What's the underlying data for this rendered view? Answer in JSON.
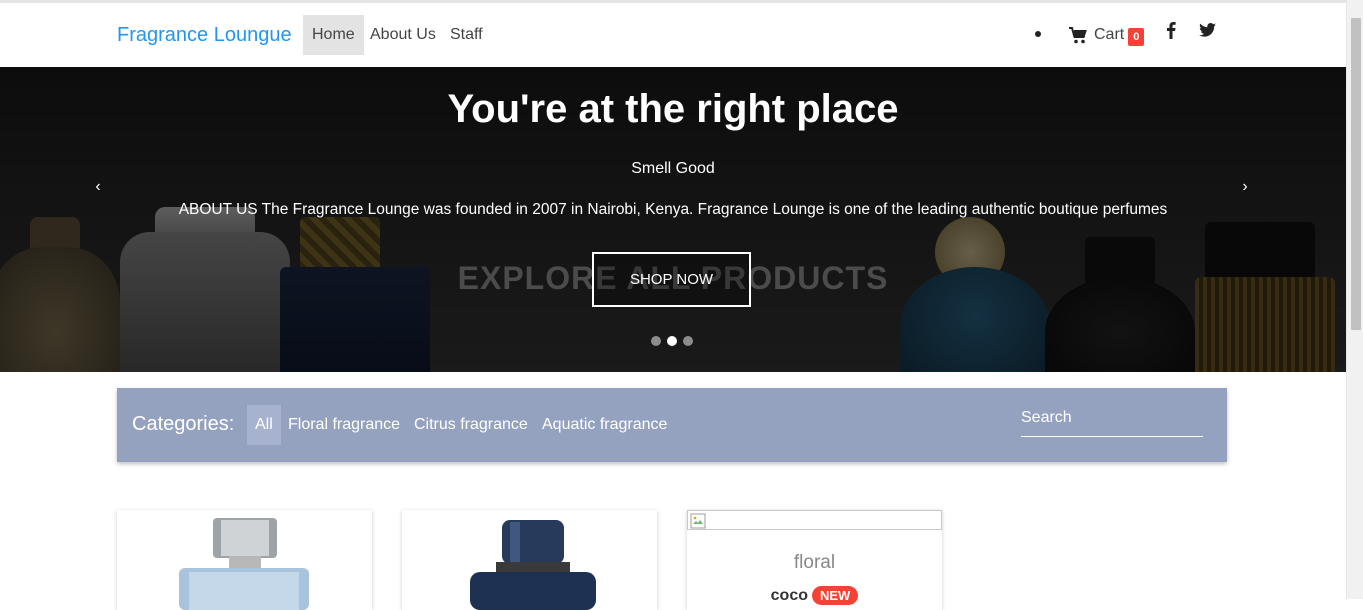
{
  "navbar": {
    "brand": "Fragrance Loungue",
    "links": [
      "Home",
      "About Us",
      "Staff"
    ],
    "cart_label": "Cart",
    "cart_count": "0",
    "social_icons": [
      "facebook-icon",
      "twitter-icon"
    ]
  },
  "hero": {
    "title": "You're at the right place",
    "subtitle": "Smell Good",
    "text": "ABOUT US The Fragrance Lounge was founded in 2007 in Nairobi, Kenya. Fragrance Lounge is one of the leading authentic boutique perfumes",
    "button": "SHOP NOW",
    "background_text": "EXPLORE ALL PRODUCTS",
    "prev": "‹",
    "next": "›",
    "slides": 3,
    "active_slide": 2
  },
  "categories": {
    "title": "Categories:",
    "items": [
      "All",
      "Floral fragrance",
      "Citrus fragrance",
      "Aquatic fragrance"
    ],
    "active": "All",
    "search_placeholder": "Search"
  },
  "products": [
    {
      "category": "",
      "name": "",
      "badge": ""
    },
    {
      "category": "",
      "name": "",
      "badge": ""
    },
    {
      "category": "floral",
      "name": "coco",
      "badge": "NEW"
    }
  ],
  "colors": {
    "brand": "#2196f3",
    "category_bar": "#94a2bf",
    "badge": "#f44336"
  }
}
